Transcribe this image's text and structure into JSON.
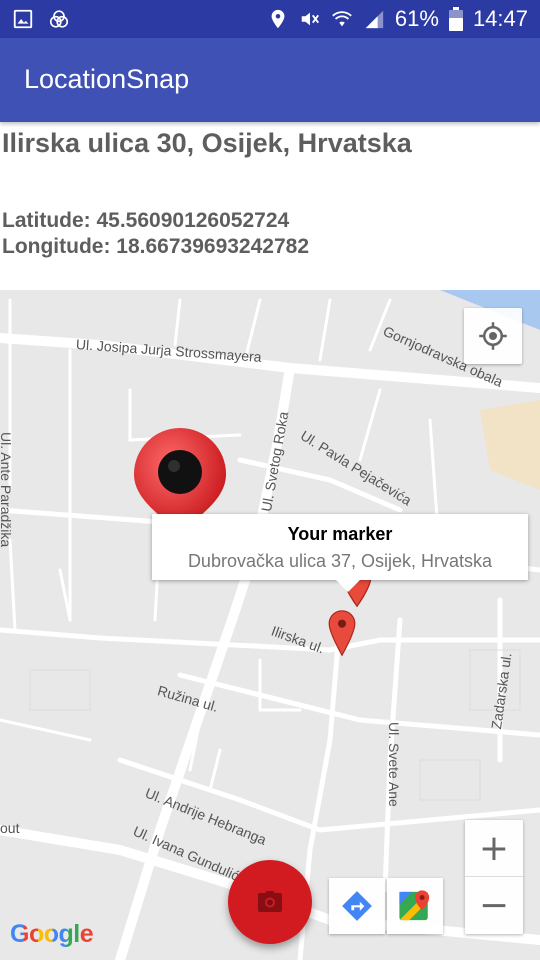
{
  "status_bar": {
    "left_icons": [
      "gallery-icon",
      "app-icon"
    ],
    "right_icons": [
      "location-icon",
      "mute-icon",
      "wifi-icon",
      "signal-icon",
      "battery-icon"
    ],
    "battery": "61%",
    "time": "14:47"
  },
  "app_bar": {
    "title": "LocationSnap"
  },
  "info": {
    "address": "Ilirska ulica 30, Osijek, Hrvatska",
    "latitude": "Latitude: 45.56090126052724",
    "longitude": "Longitude: 18.66739693242782"
  },
  "map": {
    "street_labels": {
      "strossmayera": "Ul. Josipa Jurja Strossmayera",
      "gornjodravska": "Gornjodravska obala",
      "ante_paradzika": "Ul. Ante Paradžika",
      "svetog_roka": "Ul. Svetog Roka",
      "pavla_pejacevica": "Ul. Pavla Pejačevića",
      "ilirska": "Ilirska ul.",
      "ruzina": "Ružina ul.",
      "zadarska": "Zadarska ul.",
      "svete_ane": "Ul. Svete Ane",
      "andrije_hebranga": "Ul. Andrije Hebranga",
      "ivana_gundulica": "Ul. Ivana Gundulića",
      "out": "out"
    },
    "info_window": {
      "title": "Your marker",
      "snippet": "Dubrovačka ulica 37, Osijek, Hrvatska"
    },
    "zoom_in": "+",
    "zoom_out": "−",
    "attribution": "Google",
    "colors": {
      "map_bg": "#e8e8e8",
      "road": "#ffffff",
      "marker": "#e84a3c",
      "fab": "#d21b21",
      "app_bar": "#3f51b5",
      "status_bar": "#2c3aa3"
    }
  },
  "fab": {
    "icon": "camera-icon"
  }
}
